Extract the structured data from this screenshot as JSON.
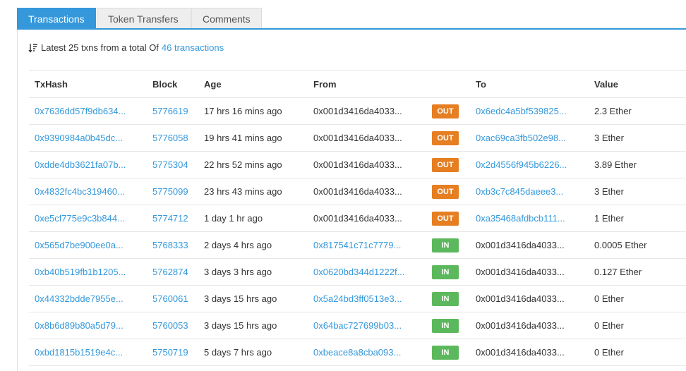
{
  "tabs": [
    {
      "label": "Transactions"
    },
    {
      "label": "Token Transfers"
    },
    {
      "label": "Comments"
    }
  ],
  "summary": {
    "prefix": "Latest 25 txns from a total Of",
    "link": "46 transactions"
  },
  "columns": {
    "txhash": "TxHash",
    "block": "Block",
    "age": "Age",
    "from": "From",
    "to": "To",
    "value": "Value"
  },
  "colors": {
    "accent": "#3498db",
    "out": "#e67e22",
    "in": "#5cb85c"
  },
  "rows": [
    {
      "hash": "0x7636dd57f9db634...",
      "block": "5776619",
      "age": "17 hrs 16 mins ago",
      "from": "0x001d3416da4033...",
      "dir": "OUT",
      "to": "0x6edc4a5bf539825...",
      "value": "2.3 Ether"
    },
    {
      "hash": "0x9390984a0b45dc...",
      "block": "5776058",
      "age": "19 hrs 41 mins ago",
      "from": "0x001d3416da4033...",
      "dir": "OUT",
      "to": "0xac69ca3fb502e98...",
      "value": "3 Ether"
    },
    {
      "hash": "0xdde4db3621fa07b...",
      "block": "5775304",
      "age": "22 hrs 52 mins ago",
      "from": "0x001d3416da4033...",
      "dir": "OUT",
      "to": "0x2d4556f945b6226...",
      "value": "3.89 Ether"
    },
    {
      "hash": "0x4832fc4bc319460...",
      "block": "5775099",
      "age": "23 hrs 43 mins ago",
      "from": "0x001d3416da4033...",
      "dir": "OUT",
      "to": "0xb3c7c845daeee3...",
      "value": "3 Ether"
    },
    {
      "hash": "0xe5cf775e9c3b844...",
      "block": "5774712",
      "age": "1 day 1 hr ago",
      "from": "0x001d3416da4033...",
      "dir": "OUT",
      "to": "0xa35468afdbcb111...",
      "value": "1 Ether"
    },
    {
      "hash": "0x565d7be900ee0a...",
      "block": "5768333",
      "age": "2 days 4 hrs ago",
      "from": "0x817541c71c7779...",
      "dir": "IN",
      "to": "0x001d3416da4033...",
      "value": "0.0005 Ether"
    },
    {
      "hash": "0xb40b519fb1b1205...",
      "block": "5762874",
      "age": "3 days 3 hrs ago",
      "from": "0x0620bd344d1222f...",
      "dir": "IN",
      "to": "0x001d3416da4033...",
      "value": "0.127 Ether"
    },
    {
      "hash": "0x44332bdde7955e...",
      "block": "5760061",
      "age": "3 days 15 hrs ago",
      "from": "0x5a24bd3ff0513e3...",
      "dir": "IN",
      "to": "0x001d3416da4033...",
      "value": "0 Ether"
    },
    {
      "hash": "0x8b6d89b80a5d79...",
      "block": "5760053",
      "age": "3 days 15 hrs ago",
      "from": "0x64bac727699b03...",
      "dir": "IN",
      "to": "0x001d3416da4033...",
      "value": "0 Ether"
    },
    {
      "hash": "0xbd1815b1519e4c...",
      "block": "5750719",
      "age": "5 days 7 hrs ago",
      "from": "0xbeace8a8cba093...",
      "dir": "IN",
      "to": "0x001d3416da4033...",
      "value": "0 Ether"
    }
  ]
}
